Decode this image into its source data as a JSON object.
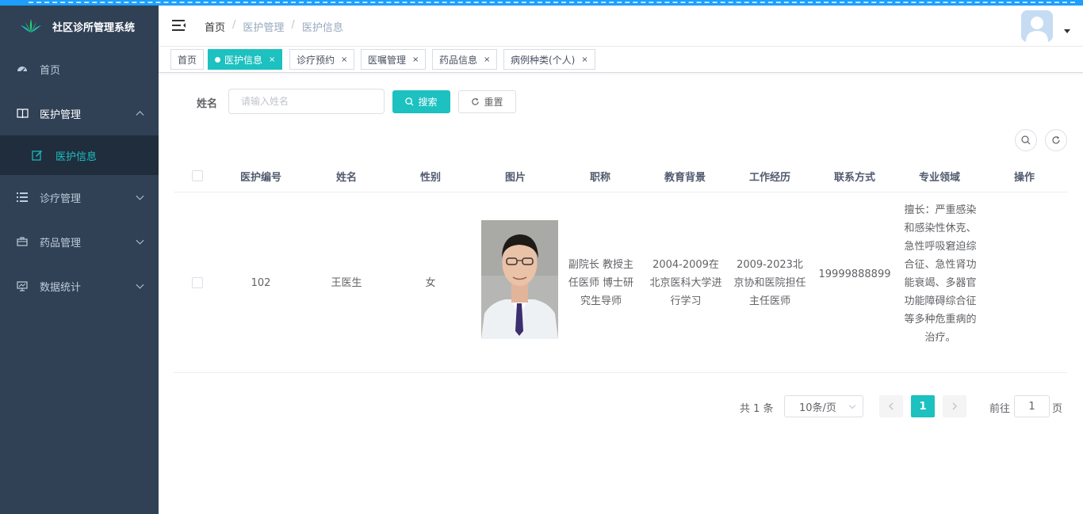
{
  "app": {
    "title": "社区诊所管理系统"
  },
  "sidebar": {
    "items": [
      {
        "label": "首页",
        "icon": "dashboard-icon"
      },
      {
        "label": "医护管理",
        "icon": "book-icon",
        "open": true,
        "children": [
          {
            "label": "医护信息",
            "icon": "edit-icon",
            "active": true
          }
        ]
      },
      {
        "label": "诊疗管理",
        "icon": "list-icon"
      },
      {
        "label": "药品管理",
        "icon": "briefcase-icon"
      },
      {
        "label": "数据统计",
        "icon": "monitor-icon"
      }
    ]
  },
  "header": {
    "breadcrumb": [
      "首页",
      "医护管理",
      "医护信息"
    ],
    "separator": "/"
  },
  "tags": [
    {
      "label": "首页",
      "active": false,
      "closable": false
    },
    {
      "label": "医护信息",
      "active": true,
      "closable": true
    },
    {
      "label": "诊疗预约",
      "active": false,
      "closable": true
    },
    {
      "label": "医嘱管理",
      "active": false,
      "closable": true
    },
    {
      "label": "药品信息",
      "active": false,
      "closable": true
    },
    {
      "label": "病例种类(个人)",
      "active": false,
      "closable": true
    }
  ],
  "tag_close": "×",
  "search": {
    "label": "姓名",
    "placeholder": "请输入姓名",
    "search_button": "搜索",
    "reset_button": "重置"
  },
  "table": {
    "columns": [
      "医护编号",
      "姓名",
      "性别",
      "图片",
      "职称",
      "教育背景",
      "工作经历",
      "联系方式",
      "专业领域",
      "操作"
    ],
    "rows": [
      {
        "id": "102",
        "name": "王医生",
        "gender": "女",
        "title": "副院长 教授主任医师 博士研究生导师",
        "education": "2004-2009在北京医科大学进行学习",
        "experience": "2009-2023北京协和医院担任主任医师",
        "phone": "19999888899",
        "specialty": "擅长：严重感染和感染性休克、急性呼吸窘迫综合征、急性肾功能衰竭、多器官功能障碍综合征等多种危重病的治疗。"
      }
    ]
  },
  "pagination": {
    "total_text": "共 1 条",
    "page_size": "10条/页",
    "current_page": "1",
    "goto_prefix": "前往",
    "goto_value": "1",
    "goto_suffix": "页"
  },
  "colors": {
    "accent": "#1cc1c0",
    "sidebar_bg": "#304156",
    "submenu_bg": "#1f2d3d",
    "top_stripe": "#1e9fff"
  }
}
